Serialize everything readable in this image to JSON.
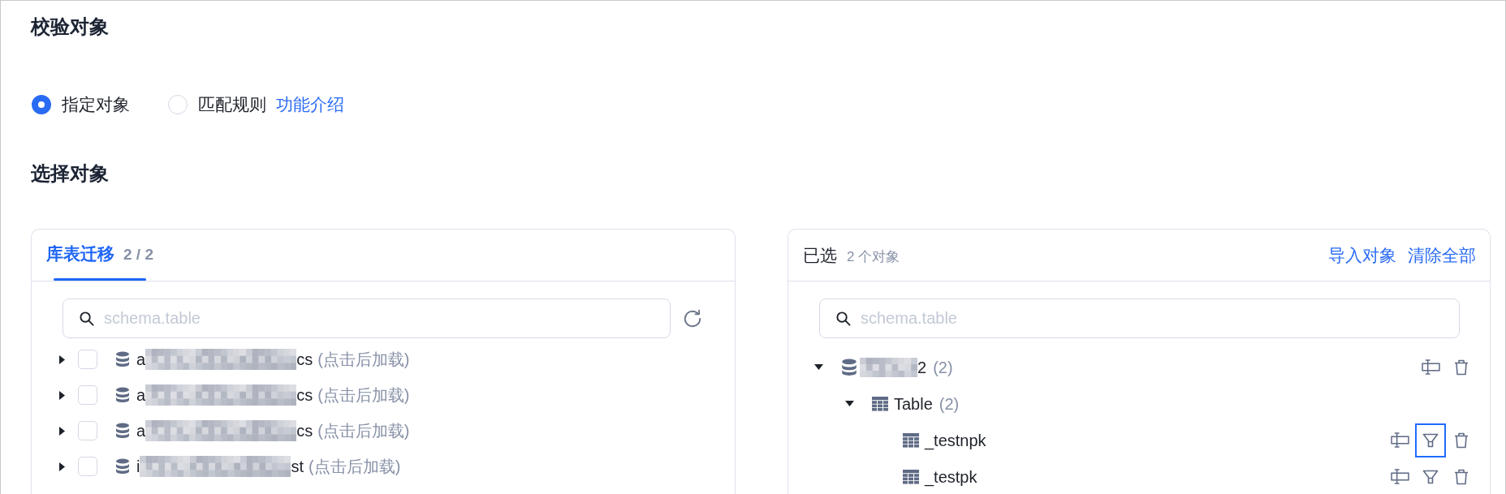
{
  "section_title": "校验对象",
  "mode_options": [
    {
      "label": "指定对象",
      "selected": true
    },
    {
      "label": "匹配规则",
      "selected": false
    }
  ],
  "help_link": "功能介绍",
  "select_title": "选择对象",
  "source_panel": {
    "tabs": [
      {
        "label": "库表迁移",
        "count": "2 / 2",
        "selected": true
      }
    ],
    "search": {
      "placeholder": "schema.table"
    },
    "items": [
      {
        "name_start": "a",
        "name_end": "cs",
        "hint": "(点击后加载)",
        "checked": false,
        "expanded": false
      },
      {
        "name_start": "a",
        "name_end": "cs",
        "hint": "(点击后加载)",
        "checked": false,
        "expanded": false
      },
      {
        "name_start": "a",
        "name_end": "cs",
        "hint": "(点击后加载)",
        "checked": false,
        "expanded": false
      },
      {
        "name_start": "i",
        "name_end": "st",
        "hint": "(点击后加载)",
        "checked": false,
        "expanded": false
      }
    ]
  },
  "selected_panel": {
    "title": "已选",
    "count": "2 个对象",
    "actions": [
      "导入对象",
      "清除全部"
    ],
    "search": {
      "placeholder": "schema.table"
    },
    "tree": [
      {
        "kind": "database",
        "name_end": "2",
        "count": "(2)",
        "expanded": true,
        "children": [
          {
            "kind": "group",
            "name": "Table",
            "count": "(2)",
            "expanded": true,
            "children": [
              {
                "kind": "table",
                "name": "_testnpk",
                "filter_focused": true
              },
              {
                "kind": "table",
                "name": "_testpk",
                "filter_focused": false
              }
            ]
          }
        ]
      }
    ]
  }
}
